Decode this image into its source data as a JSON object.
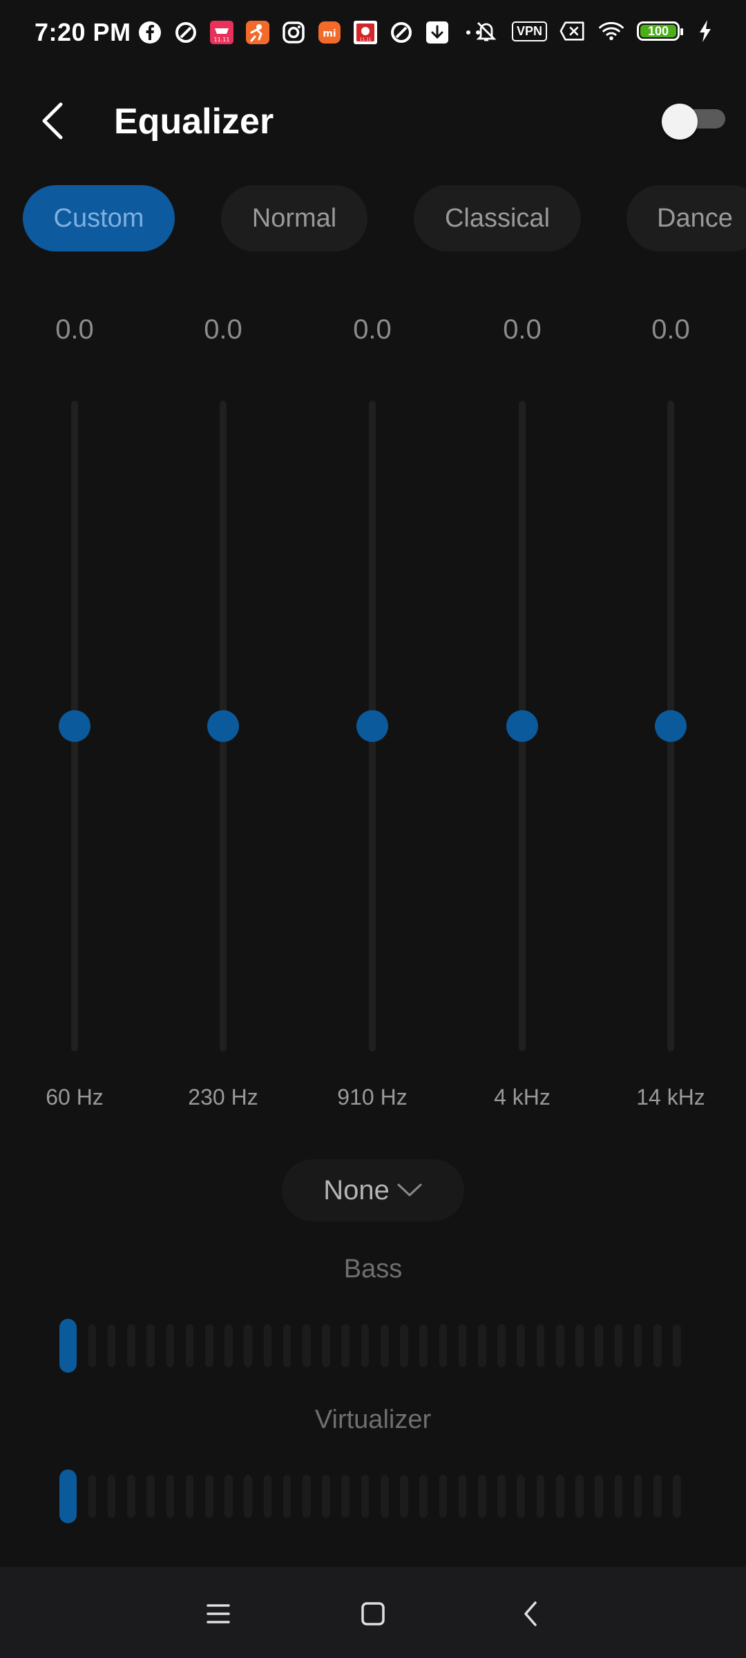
{
  "status_bar": {
    "time": "7:20 PM",
    "notification_icons": [
      "facebook-icon",
      "unknown-app-icon",
      "shopping-app-icon",
      "person-app-icon",
      "instagram-icon",
      "mi-store-icon",
      "red-app-icon",
      "unknown-app-icon",
      "download-icon",
      "more-dots-icon"
    ],
    "vpn_label": "VPN",
    "battery_level": "100",
    "colors": {
      "battery_fill": "#4caf1a"
    }
  },
  "header": {
    "title": "Equalizer",
    "enabled": false
  },
  "presets": {
    "items": [
      {
        "label": "Custom",
        "active": true
      },
      {
        "label": "Normal",
        "active": false
      },
      {
        "label": "Classical",
        "active": false
      },
      {
        "label": "Dance",
        "active": false
      }
    ]
  },
  "equalizer": {
    "bands": [
      {
        "freq": "60 Hz",
        "value": "0.0"
      },
      {
        "freq": "230 Hz",
        "value": "0.0"
      },
      {
        "freq": "910 Hz",
        "value": "0.0"
      },
      {
        "freq": "4 kHz",
        "value": "0.0"
      },
      {
        "freq": "14 kHz",
        "value": "0.0"
      }
    ]
  },
  "reverb": {
    "selected": "None"
  },
  "bass": {
    "label": "Bass",
    "level": 0,
    "segments": 32
  },
  "virtualizer": {
    "label": "Virtualizer",
    "level": 0,
    "segments": 32
  },
  "colors": {
    "accent": "#0b5a9c",
    "background": "#121212",
    "active_chip": "#0e5a9e"
  }
}
